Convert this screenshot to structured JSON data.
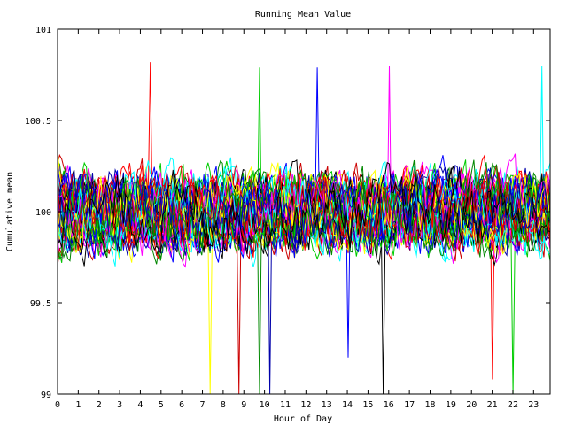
{
  "chart_data": {
    "type": "line",
    "title": "Running Mean Value",
    "xlabel": "Hour of Day",
    "ylabel": "Cumulative mean",
    "xlim": [
      0,
      23.8
    ],
    "ylim": [
      99,
      101
    ],
    "x_ticks": [
      "0",
      "1",
      "2",
      "3",
      "4",
      "5",
      "6",
      "7",
      "8",
      "9",
      "10",
      "11",
      "12",
      "13",
      "14",
      "15",
      "16",
      "17",
      "18",
      "19",
      "20",
      "21",
      "22",
      "23"
    ],
    "y_ticks": [
      "99",
      "99.5",
      "100",
      "100.5",
      "101"
    ],
    "grid": false,
    "legend": "none",
    "series_count": 60,
    "points_per_series": 240,
    "center_value": 100,
    "band": [
      99.55,
      100.55
    ],
    "colors": [
      "#ff0000",
      "#00cc00",
      "#0000ff",
      "#ff00ff",
      "#00ffff",
      "#ffff00",
      "#cc0000",
      "#008800",
      "#0000aa",
      "#000000"
    ],
    "notable_extremes": [
      {
        "x": 4.5,
        "y": 100.82
      },
      {
        "x": 9.8,
        "y": 100.79
      },
      {
        "x": 12.5,
        "y": 100.79
      },
      {
        "x": 16.0,
        "y": 100.8
      },
      {
        "x": 23.4,
        "y": 100.8
      },
      {
        "x": 7.4,
        "y": 99.0
      },
      {
        "x": 8.8,
        "y": 99.0
      },
      {
        "x": 9.8,
        "y": 99.0
      },
      {
        "x": 10.3,
        "y": 99.0
      },
      {
        "x": 15.7,
        "y": 99.0
      },
      {
        "x": 21.0,
        "y": 99.08
      },
      {
        "x": 22.0,
        "y": 99.0
      },
      {
        "x": 14.0,
        "y": 99.2
      }
    ]
  }
}
